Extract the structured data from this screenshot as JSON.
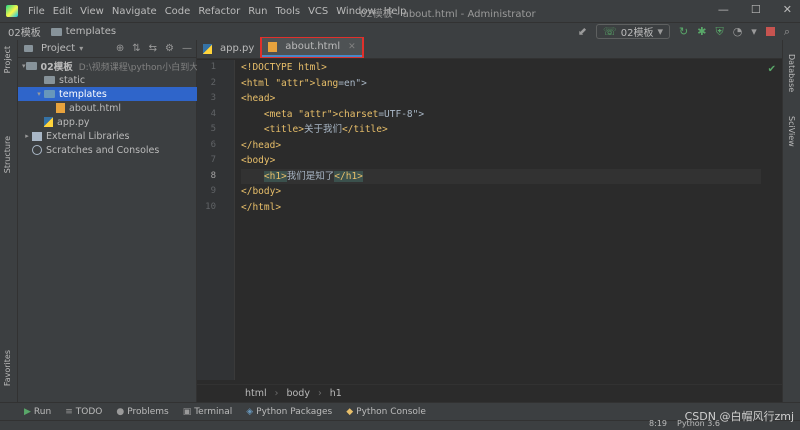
{
  "menu": [
    "File",
    "Edit",
    "View",
    "Navigate",
    "Code",
    "Refactor",
    "Run",
    "Tools",
    "VCS",
    "Window",
    "Help"
  ],
  "window_title": "02模板 - about.html - Administrator",
  "window_controls": {
    "minimize": "—",
    "maximize": "☐",
    "close": "✕"
  },
  "breadcrumb": {
    "project": "02模板",
    "folder": "templates"
  },
  "run_config": "02模板",
  "project_panel": {
    "title": "Project",
    "tree": [
      {
        "label": "02模板",
        "hint": "D:\\视频课程\\python小白到大神",
        "depth": 0,
        "kind": "folder",
        "expanded": true
      },
      {
        "label": "static",
        "hint": "",
        "depth": 1,
        "kind": "folder"
      },
      {
        "label": "templates",
        "hint": "",
        "depth": 1,
        "kind": "folder-blue",
        "expanded": true,
        "selected": true
      },
      {
        "label": "about.html",
        "hint": "",
        "depth": 2,
        "kind": "html"
      },
      {
        "label": "app.py",
        "hint": "",
        "depth": 1,
        "kind": "py"
      },
      {
        "label": "External Libraries",
        "hint": "",
        "depth": 0,
        "kind": "lib",
        "collapsed": true
      },
      {
        "label": "Scratches and Consoles",
        "hint": "",
        "depth": 0,
        "kind": "scratch"
      }
    ]
  },
  "editor": {
    "tabs": [
      {
        "label": "app.py",
        "active": false
      },
      {
        "label": "about.html",
        "active": true
      }
    ],
    "current_line": 8,
    "lines": [
      "<!DOCTYPE html>",
      "<html lang=\"en\">",
      "<head>",
      "    <meta charset=\"UTF-8\">",
      "    <title>关于我们</title>",
      "</head>",
      "<body>",
      "    <h1>我们是知了</h1>",
      "</body>",
      "</html>"
    ],
    "breadcrumb": [
      "html",
      "body",
      "h1"
    ]
  },
  "left_tool_tabs": [
    "Project",
    "Structure",
    "Favorites"
  ],
  "right_tool_tabs": [
    "Database",
    "SciView"
  ],
  "bottom_tabs": [
    "Run",
    "TODO",
    "Problems",
    "Terminal",
    "Python Packages",
    "Python Console"
  ],
  "status": {
    "position": "8:19",
    "interpreter": "Python 3.6"
  },
  "watermark": "CSDN @白帽风行zmj",
  "colors": {
    "accent": "#2f65ca",
    "tab_highlight": "#e0302b",
    "tag": "#e8bf6a",
    "string": "#6a8759"
  }
}
